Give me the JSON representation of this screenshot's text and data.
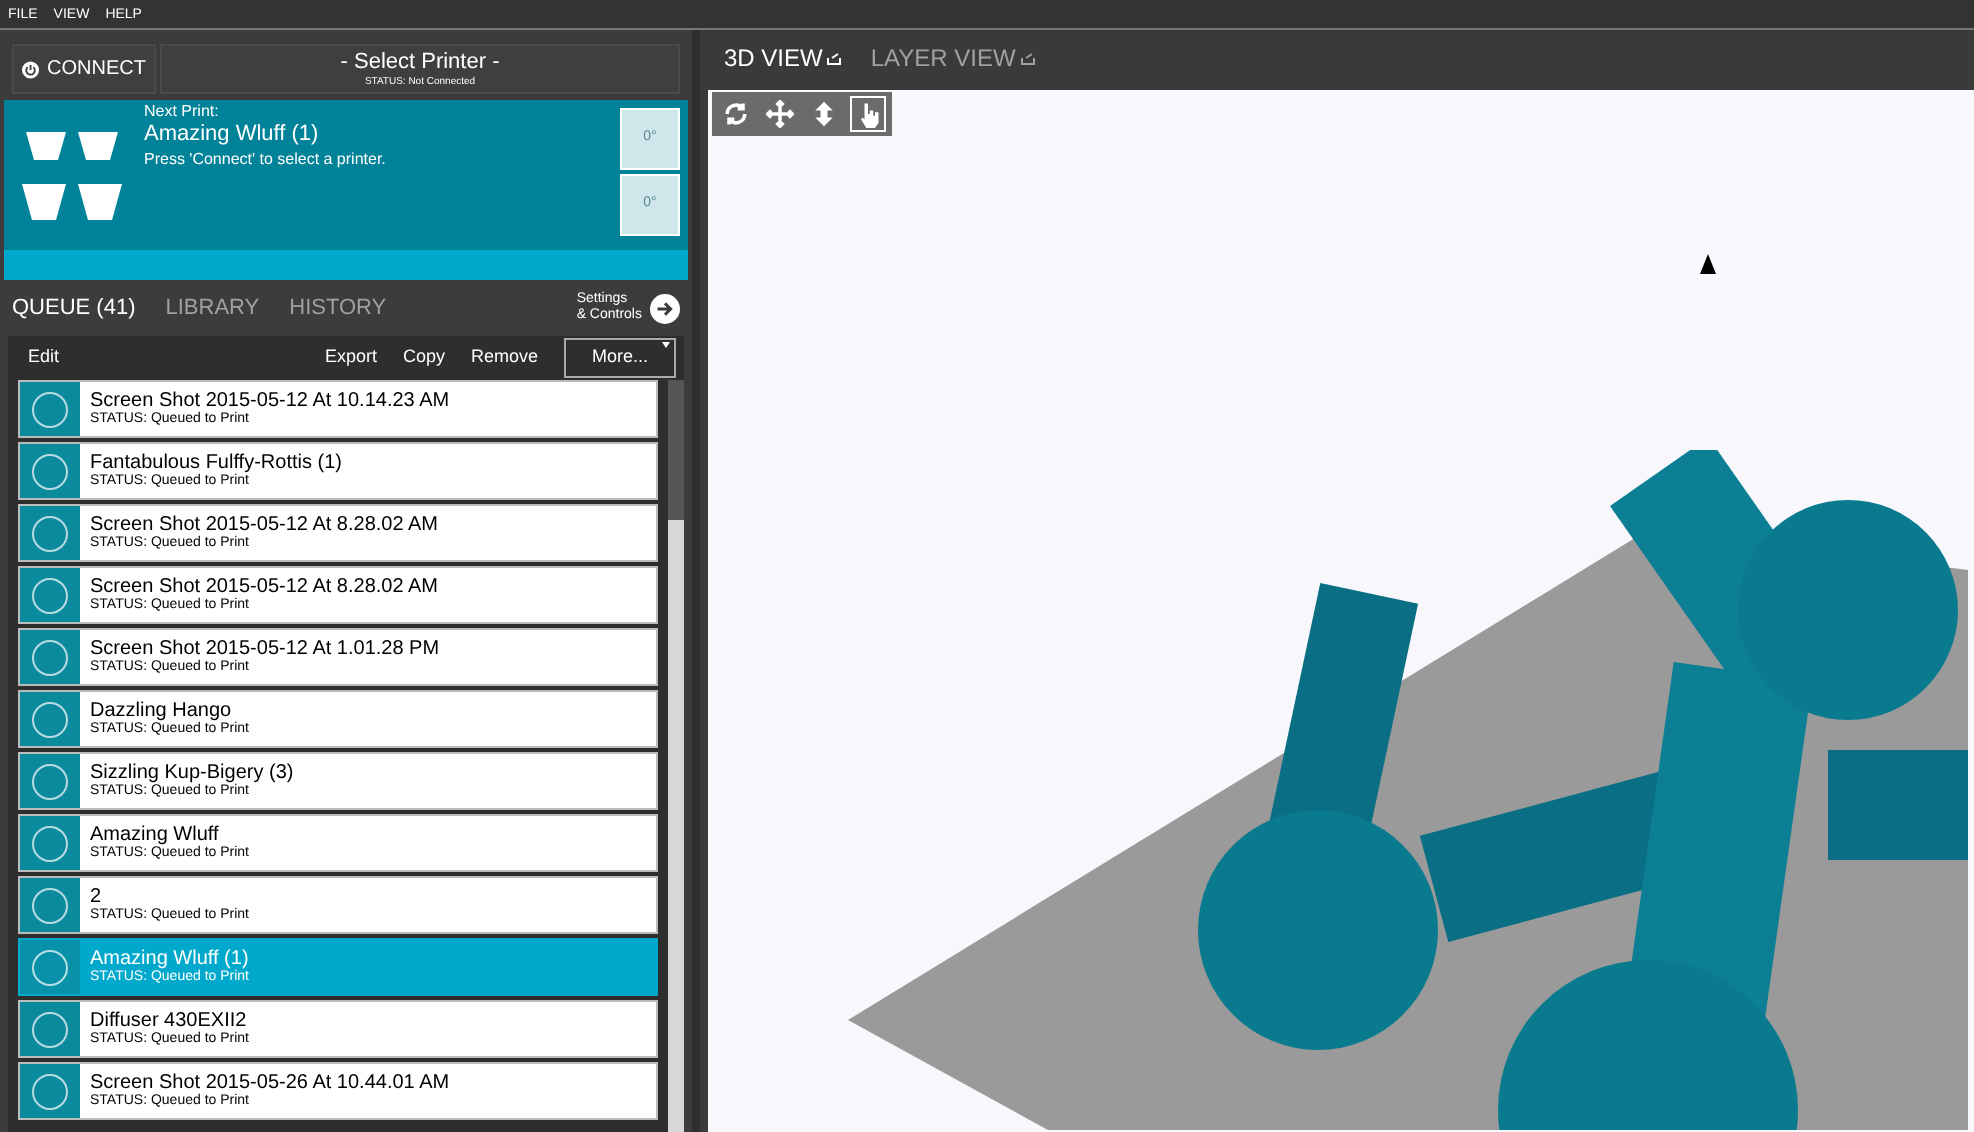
{
  "menu": [
    "FILE",
    "VIEW",
    "HELP"
  ],
  "printer": {
    "connect": "CONNECT",
    "title": "- Select Printer -",
    "status": "STATUS: Not Connected"
  },
  "next_print": {
    "label": "Next Print:",
    "name": "Amazing Wluff (1)",
    "hint": "Press 'Connect' to select a printer.",
    "temps": [
      "0°",
      "0°"
    ]
  },
  "tabs": [
    {
      "label": "QUEUE (41)",
      "selected": true
    },
    {
      "label": "LIBRARY",
      "selected": false
    },
    {
      "label": "HISTORY",
      "selected": false
    }
  ],
  "settings_link": "Settings\n& Controls",
  "toolbar": {
    "edit": "Edit",
    "actions": [
      "Export",
      "Copy",
      "Remove"
    ],
    "more": "More..."
  },
  "queue": [
    {
      "name": "Screen Shot 2015-05-12 At 10.14.23 AM",
      "status": "STATUS: Queued to Print",
      "selected": false
    },
    {
      "name": "Fantabulous Fulffy-Rottis (1)",
      "status": "STATUS: Queued to Print",
      "selected": false
    },
    {
      "name": "Screen Shot 2015-05-12 At 8.28.02 AM",
      "status": "STATUS: Queued to Print",
      "selected": false
    },
    {
      "name": "Screen Shot 2015-05-12 At 8.28.02 AM",
      "status": "STATUS: Queued to Print",
      "selected": false
    },
    {
      "name": "Screen Shot 2015-05-12 At 1.01.28 PM",
      "status": "STATUS: Queued to Print",
      "selected": false
    },
    {
      "name": "Dazzling Hango",
      "status": "STATUS: Queued to Print",
      "selected": false
    },
    {
      "name": "Sizzling Kup-Bigery (3)",
      "status": "STATUS: Queued to Print",
      "selected": false
    },
    {
      "name": "Amazing Wluff",
      "status": "STATUS: Queued to Print",
      "selected": false
    },
    {
      "name": "2",
      "status": "STATUS: Queued to Print",
      "selected": false
    },
    {
      "name": "Amazing Wluff (1)",
      "status": "STATUS: Queued to Print",
      "selected": true
    },
    {
      "name": "Diffuser 430EXII2",
      "status": "STATUS: Queued to Print",
      "selected": false
    },
    {
      "name": "Screen Shot 2015-05-26 At 10.44.01 AM",
      "status": "STATUS: Queued to Print",
      "selected": false
    }
  ],
  "view_tabs": [
    {
      "label": "3D VIEW",
      "selected": true
    },
    {
      "label": "LAYER VIEW",
      "selected": false
    }
  ],
  "view_tools": [
    {
      "kind": "rotate",
      "selected": false
    },
    {
      "kind": "move",
      "selected": false
    },
    {
      "kind": "zoom",
      "selected": false
    },
    {
      "kind": "part",
      "selected": true
    }
  ]
}
